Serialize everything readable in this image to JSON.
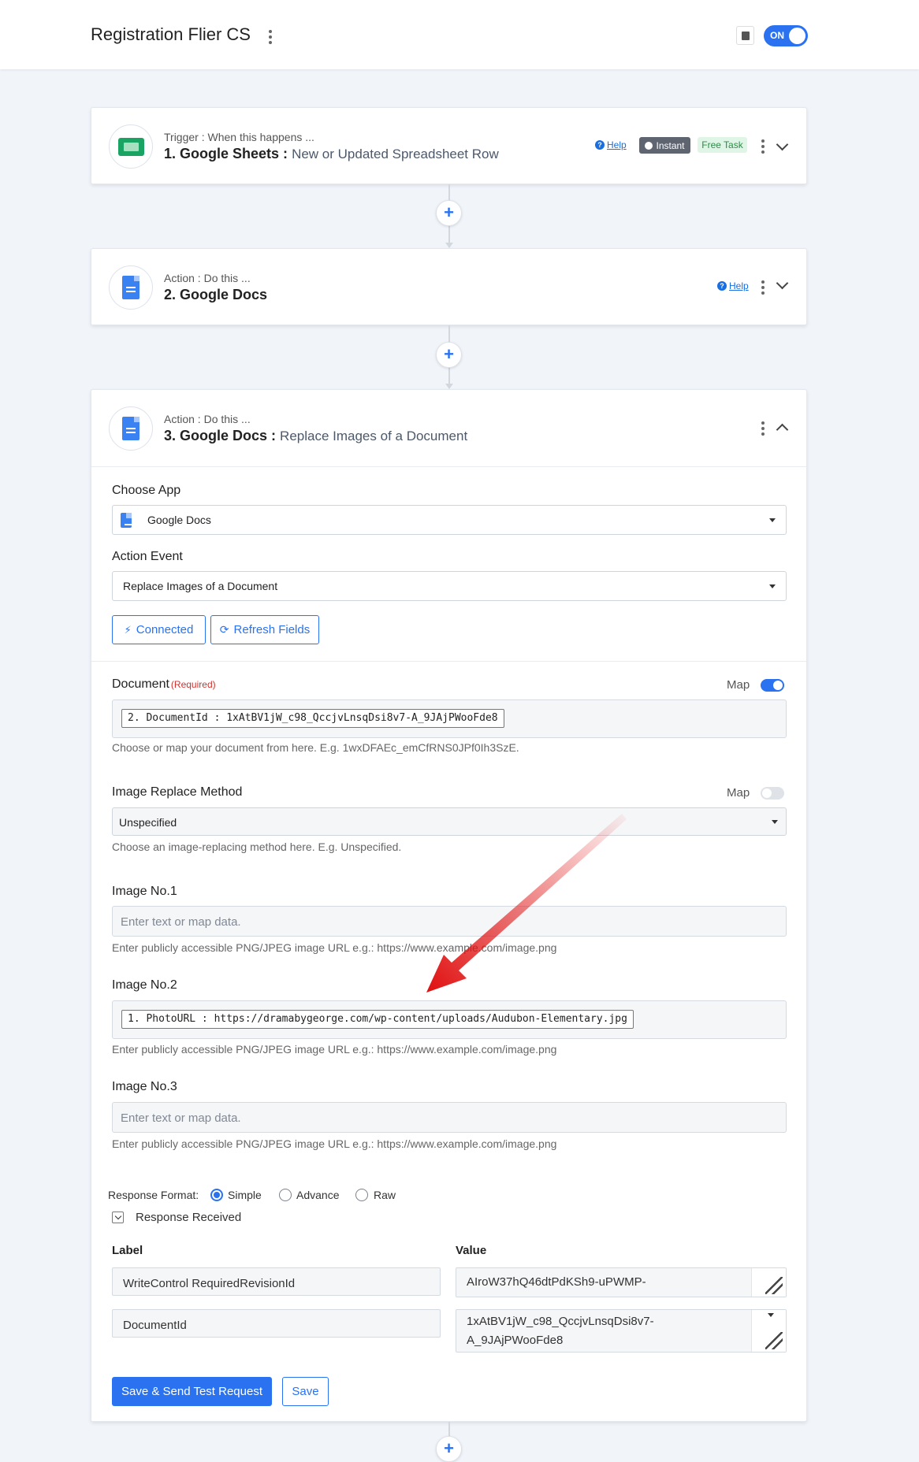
{
  "header": {
    "workflow_title": "Registration Flier CS",
    "toggle_label": "ON"
  },
  "steps": [
    {
      "subtitle": "Trigger : When this happens ...",
      "title": "1. Google Sheets :",
      "event": "New or Updated Spreadsheet Row",
      "help_label": "Help",
      "badge_instant": "Instant",
      "badge_free": "Free Task"
    },
    {
      "subtitle": "Action : Do this ...",
      "title": "2. Google Docs",
      "event": "",
      "help_label": "Help"
    },
    {
      "subtitle": "Action : Do this ...",
      "title": "3. Google Docs :",
      "event": "Replace Images of a Document"
    }
  ],
  "config": {
    "choose_app_label": "Choose App",
    "choose_app_value": "Google Docs",
    "action_event_label": "Action Event",
    "action_event_value": "Replace Images of a Document",
    "connected_label": "Connected",
    "refresh_label": "Refresh Fields",
    "map_label": "Map",
    "required_label": "(Required)",
    "document": {
      "label": "Document",
      "map_on": true,
      "token": "2. DocumentId : 1xAtBV1jW_c98_QccjvLnsqDsi8v7-A_9JAjPWooFde8",
      "hint": "Choose or map your document from here. E.g. 1wxDFAEc_emCfRNS0JPf0Ih3SzE."
    },
    "replace_method": {
      "label": "Image Replace Method",
      "map_on": false,
      "value": "Unspecified",
      "hint": "Choose an image-replacing method here. E.g. Unspecified."
    },
    "image1": {
      "label": "Image No.1",
      "placeholder": "Enter text or map data.",
      "hint": "Enter publicly accessible PNG/JPEG image URL e.g.: https://www.example.com/image.png"
    },
    "image2": {
      "label": "Image No.2",
      "token": "1. PhotoURL : https://dramabygeorge.com/wp-content/uploads/Audubon-Elementary.jpg",
      "hint": "Enter publicly accessible PNG/JPEG image URL e.g.: https://www.example.com/image.png"
    },
    "image3": {
      "label": "Image No.3",
      "placeholder": "Enter text or map data.",
      "hint": "Enter publicly accessible PNG/JPEG image URL e.g.: https://www.example.com/image.png"
    }
  },
  "response": {
    "format_label": "Response Format:",
    "options": [
      "Simple",
      "Advance",
      "Raw"
    ],
    "selected": "Simple",
    "received_label": "Response Received",
    "col_label": "Label",
    "col_value": "Value",
    "rows": [
      {
        "label": "WriteControl RequiredRevisionId",
        "value": "AIroW37hQ46dtPdKSh9-uPWMP-"
      },
      {
        "label": "DocumentId",
        "value": "1xAtBV1jW_c98_QccjvLnsqDsi8v7-A_9JAjPWooFde8"
      }
    ]
  },
  "buttons": {
    "save_send": "Save & Send Test Request",
    "save": "Save"
  },
  "colors": {
    "primary": "#2a72f0",
    "annotation_arrow": "#e01010"
  }
}
